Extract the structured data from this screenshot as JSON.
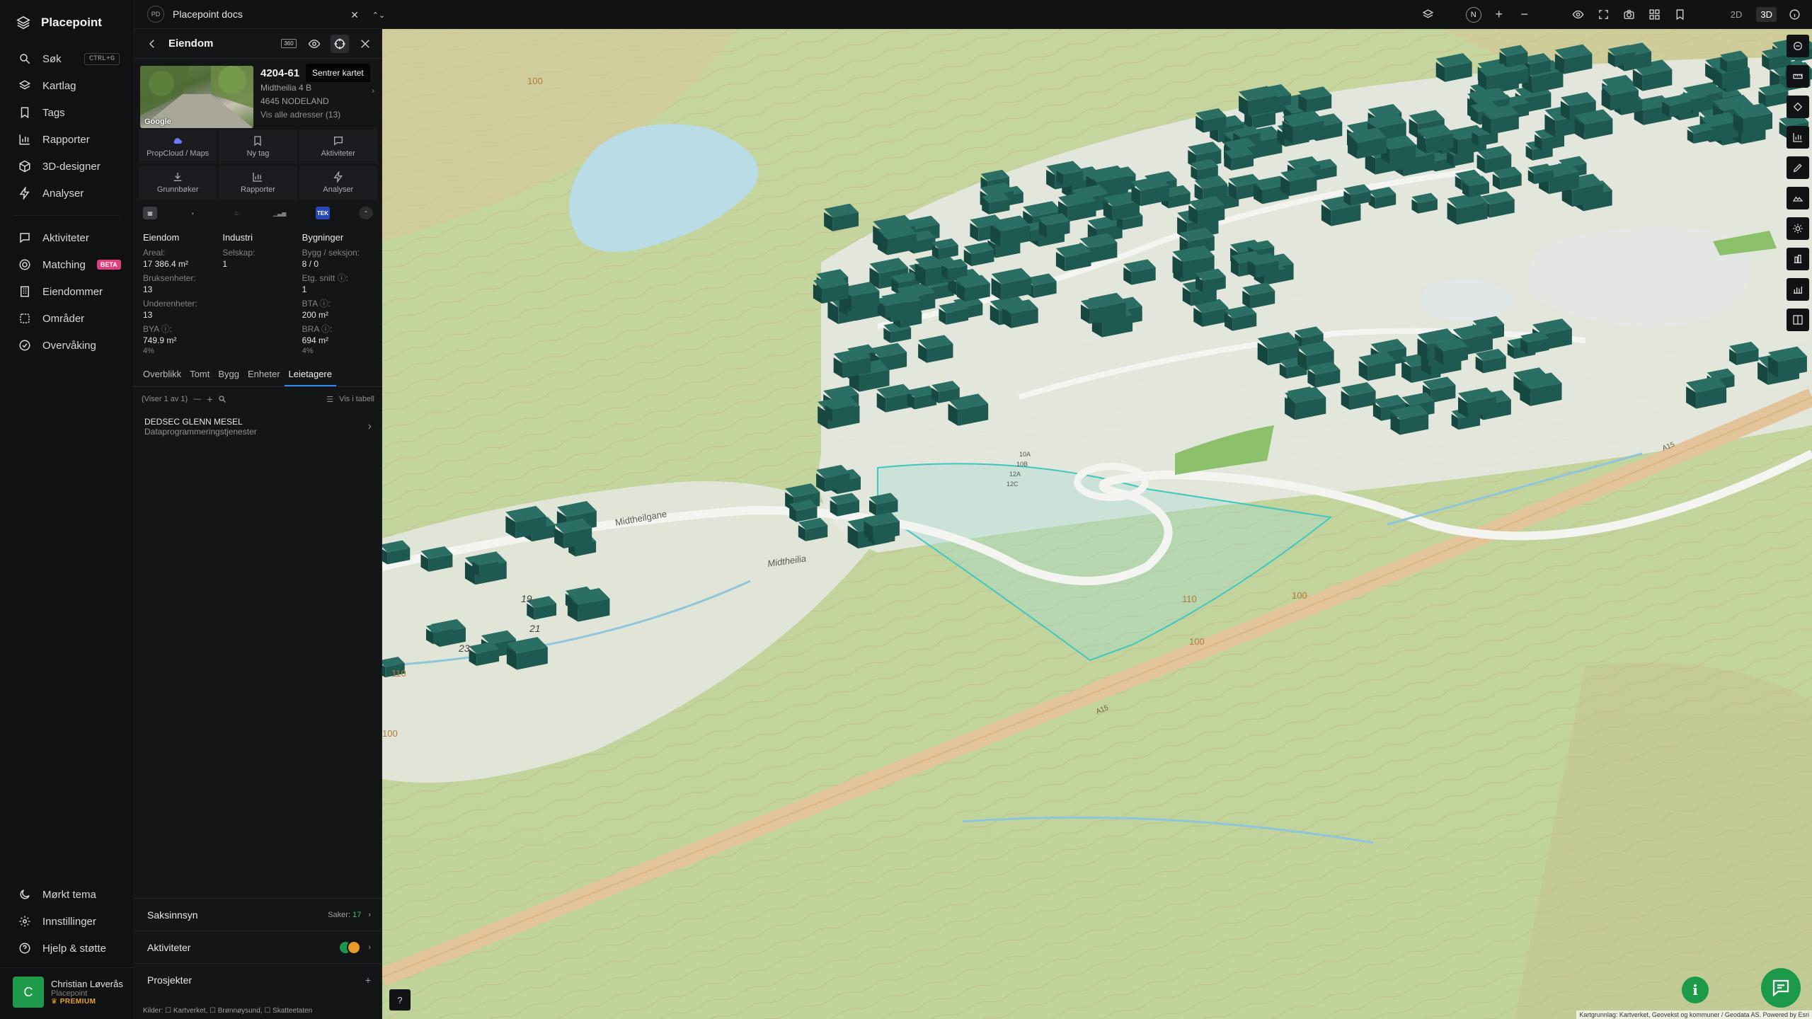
{
  "app": {
    "name": "Placepoint"
  },
  "nav": {
    "items": [
      {
        "label": "Søk",
        "icon": "search-icon",
        "shortcut": "CTRL+G"
      },
      {
        "label": "Kartlag",
        "icon": "layers-icon"
      },
      {
        "label": "Tags",
        "icon": "bookmark-icon"
      },
      {
        "label": "Rapporter",
        "icon": "bar-chart-icon"
      },
      {
        "label": "3D-designer",
        "icon": "cube-icon"
      },
      {
        "label": "Analyser",
        "icon": "bolt-icon"
      }
    ],
    "items2": [
      {
        "label": "Aktiviteter",
        "icon": "chat-icon"
      },
      {
        "label": "Matching",
        "icon": "target-icon",
        "badge": "BETA"
      },
      {
        "label": "Eiendommer",
        "icon": "building-icon"
      },
      {
        "label": "Områder",
        "icon": "area-icon"
      },
      {
        "label": "Overvåking",
        "icon": "eye-check-icon"
      }
    ],
    "bottom": [
      {
        "label": "Mørkt tema",
        "icon": "moon-icon"
      },
      {
        "label": "Innstillinger",
        "icon": "gear-icon"
      },
      {
        "label": "Hjelp & støtte",
        "icon": "help-icon"
      }
    ],
    "user": {
      "initial": "C",
      "name": "Christian Løverås",
      "org": "Placepoint",
      "plan": "PREMIUM"
    }
  },
  "topbar": {
    "doc_badge": "PD",
    "doc_title": "Placepoint docs",
    "view_2d": "2D",
    "view_3d": "3D",
    "north": "N"
  },
  "panel": {
    "title": "Eiendom",
    "badge_360": "360",
    "tooltip": "Sentrer kartet",
    "property": {
      "photo_credit": "Google",
      "gnr": "4204-61",
      "address": "Midtheilia 4 B",
      "postal": "4645 NODELAND",
      "link": "Vis alle adresser (13)"
    },
    "actions": [
      {
        "label": "PropCloud / Maps",
        "icon": "cloud-icon"
      },
      {
        "label": "Ny tag",
        "icon": "bookmark-icon"
      },
      {
        "label": "Aktiviteter",
        "icon": "chat-icon"
      },
      {
        "label": "Grunnbøker",
        "icon": "download-icon"
      },
      {
        "label": "Rapporter",
        "icon": "bar-chart-icon"
      },
      {
        "label": "Analyser",
        "icon": "bolt-icon"
      }
    ],
    "source_badge": "TEK",
    "facts": {
      "col1": {
        "header": "Eiendom",
        "areal_label": "Areal:",
        "areal": "17 386.4 m²",
        "bruks_label": "Bruksenheter:",
        "bruks": "13",
        "under_label": "Underenheter:",
        "under": "13",
        "bya_label": "BYA ⓘ:",
        "bya": "749.9 m²",
        "bya_pct": "4%"
      },
      "col2": {
        "header": "Industri",
        "selskap_label": "Selskap:",
        "selskap": "1"
      },
      "col3": {
        "header": "Bygninger",
        "bygg_label": "Bygg / seksjon:",
        "bygg": "8 / 0",
        "etg_label": "Etg. snitt ⓘ:",
        "etg": "1",
        "bta_label": "BTA ⓘ:",
        "bta": "200 m²",
        "bra_label": "BRA ⓘ:",
        "bra": "694 m²",
        "bra_pct": "4%"
      }
    },
    "tabs": [
      "Overblikk",
      "Tomt",
      "Bygg",
      "Enheter",
      "Leietagere"
    ],
    "active_tab": 4,
    "list": {
      "counter": "(Viser 1 av 1)",
      "table_toggle": "Vis i tabell",
      "tenants": [
        {
          "name": "DEDSEC GLENN MESEL",
          "sub": "Dataprogrammeringstjenester"
        }
      ]
    },
    "accordions": {
      "saksinnsyn": {
        "label": "Saksinnsyn",
        "count_label": "Saker:",
        "count": "17"
      },
      "aktiviteter": {
        "label": "Aktiviteter"
      },
      "prosjekter": {
        "label": "Prosjekter",
        "add": "+"
      }
    },
    "sources": "Kilder: ☐ Kartverket, ☐ Brønnøysund, ☐ Skatteetaten"
  },
  "map": {
    "labels": [
      "Midtheilia",
      "Midtheilgane",
      "A15",
      "A15",
      "100",
      "100",
      "110",
      "100",
      "100",
      "110",
      "19",
      "21",
      "23",
      "10A",
      "10B",
      "12A",
      "12C"
    ],
    "attribution": "Kartgrunnlag: Kartverket, Geovekst og kommuner / Geodata AS. Powered by Esri",
    "colors": {
      "terrain": "#c8d9a4",
      "building": "#1e5a52",
      "water": "#b9dce6",
      "road": "#e3c49a",
      "selection": "#3fc7c0"
    }
  }
}
